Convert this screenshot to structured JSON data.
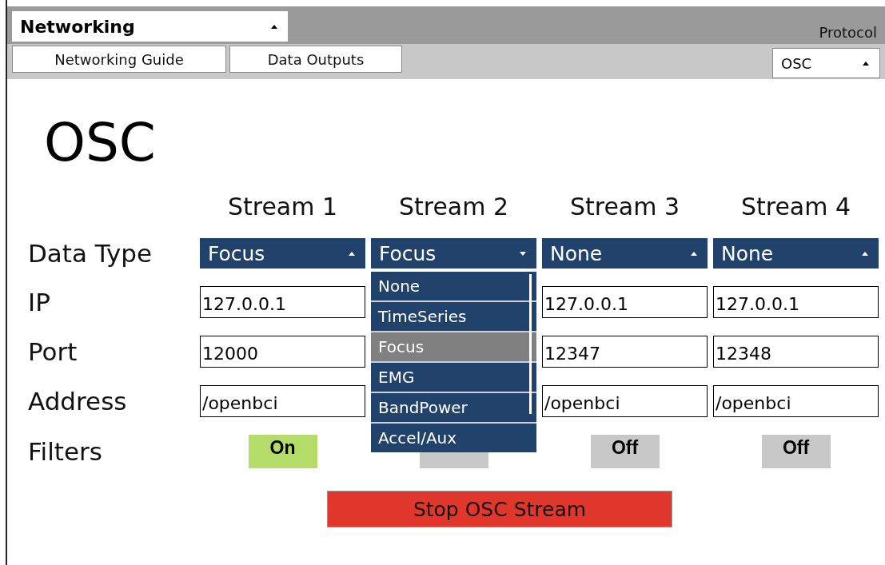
{
  "widget_selector": {
    "value": "Networking"
  },
  "top_buttons": [
    "Networking Guide",
    "Data Outputs"
  ],
  "protocol": {
    "label": "Protocol",
    "value": "OSC"
  },
  "title": "OSC",
  "row_labels": [
    "Data Type",
    "IP",
    "Port",
    "Address",
    "Filters"
  ],
  "streams": [
    {
      "name": "Stream 1",
      "data_type": {
        "value": "Focus",
        "open": false
      },
      "ip": "127.0.0.1",
      "port": "12000",
      "address": "/openbci",
      "filter": {
        "label": "On",
        "on": true
      }
    },
    {
      "name": "Stream 2",
      "data_type": {
        "value": "Focus",
        "open": true,
        "options": [
          {
            "label": "None",
            "selected": false
          },
          {
            "label": "TimeSeries",
            "selected": false
          },
          {
            "label": "Focus",
            "selected": true
          },
          {
            "label": "EMG",
            "selected": false
          },
          {
            "label": "BandPower",
            "selected": false
          },
          {
            "label": "Accel/Aux",
            "selected": false
          }
        ]
      },
      "filter": {
        "on": false
      }
    },
    {
      "name": "Stream 3",
      "data_type": {
        "value": "None",
        "open": false
      },
      "ip": "127.0.0.1",
      "port": "12347",
      "address": "/openbci",
      "filter": {
        "label": "Off",
        "on": false
      }
    },
    {
      "name": "Stream 4",
      "data_type": {
        "value": "None",
        "open": false
      },
      "ip": "127.0.0.1",
      "port": "12348",
      "address": "/openbci",
      "filter": {
        "label": "Off",
        "on": false
      }
    }
  ],
  "stop_button": "Stop OSC Stream"
}
